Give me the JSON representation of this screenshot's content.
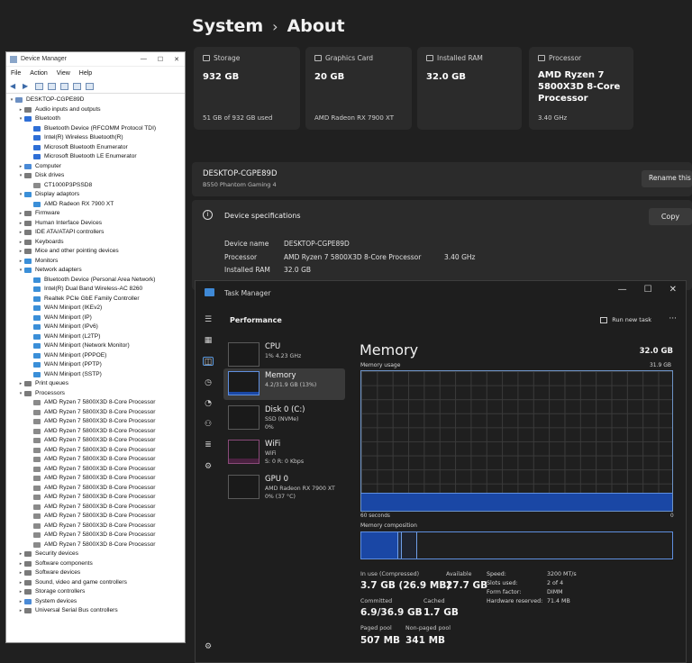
{
  "settings": {
    "crumb_parent": "System",
    "crumb_sep": "›",
    "crumb_current": "About",
    "cards": [
      {
        "label": "Storage",
        "value": "932 GB",
        "sub": "51 GB of 932 GB used"
      },
      {
        "label": "Graphics Card",
        "value": "20 GB",
        "sub": "AMD Radeon RX 7900 XT"
      },
      {
        "label": "Installed RAM",
        "value": "32.0 GB",
        "sub": ""
      },
      {
        "label": "Processor",
        "value": "AMD Ryzen 7 5800X3D 8-Core Processor",
        "sub": "3.40 GHz"
      }
    ],
    "device_name": "DESKTOP-CGPE89D",
    "device_model": "B550 Phantom Gaming 4",
    "rename_label": "Rename this",
    "spec_header": "Device specifications",
    "copy_label": "Copy",
    "specs": [
      {
        "key": "Device name",
        "value": "DESKTOP-CGPE89D",
        "extra": ""
      },
      {
        "key": "Processor",
        "value": "AMD Ryzen 7 5800X3D 8-Core Processor",
        "extra": "3.40 GHz"
      },
      {
        "key": "Installed RAM",
        "value": "32.0 GB",
        "extra": ""
      }
    ]
  },
  "device_manager": {
    "title": "Device Manager",
    "menu": [
      "File",
      "Action",
      "View",
      "Help"
    ],
    "tree": [
      {
        "t": "DESKTOP-CGPE89D",
        "l": 0,
        "a": "v",
        "c": "#6b8fc2"
      },
      {
        "t": "Audio inputs and outputs",
        "l": 1,
        "a": ">",
        "c": "#7a7a7a"
      },
      {
        "t": "Bluetooth",
        "l": 1,
        "a": "v",
        "c": "#2f6fd6"
      },
      {
        "t": "Bluetooth Device (RFCOMM Protocol TDI)",
        "l": 2,
        "a": "",
        "c": "#2f6fd6"
      },
      {
        "t": "Intel(R) Wireless Bluetooth(R)",
        "l": 2,
        "a": "",
        "c": "#2f6fd6"
      },
      {
        "t": "Microsoft Bluetooth Enumerator",
        "l": 2,
        "a": "",
        "c": "#2f6fd6"
      },
      {
        "t": "Microsoft Bluetooth LE Enumerator",
        "l": 2,
        "a": "",
        "c": "#2f6fd6"
      },
      {
        "t": "Computer",
        "l": 1,
        "a": ">",
        "c": "#4a8ad6"
      },
      {
        "t": "Disk drives",
        "l": 1,
        "a": "v",
        "c": "#7a7a7a"
      },
      {
        "t": "CT1000P3PSSD8",
        "l": 2,
        "a": "",
        "c": "#8a8a8a"
      },
      {
        "t": "Display adaptors",
        "l": 1,
        "a": "v",
        "c": "#3b8fd8"
      },
      {
        "t": "AMD Radeon RX 7900 XT",
        "l": 2,
        "a": "",
        "c": "#3b8fd8"
      },
      {
        "t": "Firmware",
        "l": 1,
        "a": ">",
        "c": "#7a7a7a"
      },
      {
        "t": "Human Interface Devices",
        "l": 1,
        "a": ">",
        "c": "#7a7a7a"
      },
      {
        "t": "IDE ATA/ATAPI controllers",
        "l": 1,
        "a": ">",
        "c": "#7a7a7a"
      },
      {
        "t": "Keyboards",
        "l": 1,
        "a": ">",
        "c": "#7a7a7a"
      },
      {
        "t": "Mice and other pointing devices",
        "l": 1,
        "a": ">",
        "c": "#7a7a7a"
      },
      {
        "t": "Monitors",
        "l": 1,
        "a": ">",
        "c": "#3b8fd8"
      },
      {
        "t": "Network adapters",
        "l": 1,
        "a": "v",
        "c": "#3b8fd8"
      },
      {
        "t": "Bluetooth Device (Personal Area Network)",
        "l": 2,
        "a": "",
        "c": "#3b8fd8"
      },
      {
        "t": "Intel(R) Dual Band Wireless-AC 8260",
        "l": 2,
        "a": "",
        "c": "#3b8fd8"
      },
      {
        "t": "Realtek PCIe GbE Family Controller",
        "l": 2,
        "a": "",
        "c": "#3b8fd8"
      },
      {
        "t": "WAN Miniport (IKEv2)",
        "l": 2,
        "a": "",
        "c": "#3b8fd8"
      },
      {
        "t": "WAN Miniport (IP)",
        "l": 2,
        "a": "",
        "c": "#3b8fd8"
      },
      {
        "t": "WAN Miniport (IPv6)",
        "l": 2,
        "a": "",
        "c": "#3b8fd8"
      },
      {
        "t": "WAN Miniport (L2TP)",
        "l": 2,
        "a": "",
        "c": "#3b8fd8"
      },
      {
        "t": "WAN Miniport (Network Monitor)",
        "l": 2,
        "a": "",
        "c": "#3b8fd8"
      },
      {
        "t": "WAN Miniport (PPPOE)",
        "l": 2,
        "a": "",
        "c": "#3b8fd8"
      },
      {
        "t": "WAN Miniport (PPTP)",
        "l": 2,
        "a": "",
        "c": "#3b8fd8"
      },
      {
        "t": "WAN Miniport (SSTP)",
        "l": 2,
        "a": "",
        "c": "#3b8fd8"
      },
      {
        "t": "Print queues",
        "l": 1,
        "a": ">",
        "c": "#7a7a7a"
      },
      {
        "t": "Processors",
        "l": 1,
        "a": "v",
        "c": "#7a7a7a"
      },
      {
        "t": "AMD Ryzen 7 5800X3D 8-Core Processor",
        "l": 2,
        "a": "",
        "c": "#8a8a8a"
      },
      {
        "t": "AMD Ryzen 7 5800X3D 8-Core Processor",
        "l": 2,
        "a": "",
        "c": "#8a8a8a"
      },
      {
        "t": "AMD Ryzen 7 5800X3D 8-Core Processor",
        "l": 2,
        "a": "",
        "c": "#8a8a8a"
      },
      {
        "t": "AMD Ryzen 7 5800X3D 8-Core Processor",
        "l": 2,
        "a": "",
        "c": "#8a8a8a"
      },
      {
        "t": "AMD Ryzen 7 5800X3D 8-Core Processor",
        "l": 2,
        "a": "",
        "c": "#8a8a8a"
      },
      {
        "t": "AMD Ryzen 7 5800X3D 8-Core Processor",
        "l": 2,
        "a": "",
        "c": "#8a8a8a"
      },
      {
        "t": "AMD Ryzen 7 5800X3D 8-Core Processor",
        "l": 2,
        "a": "",
        "c": "#8a8a8a"
      },
      {
        "t": "AMD Ryzen 7 5800X3D 8-Core Processor",
        "l": 2,
        "a": "",
        "c": "#8a8a8a"
      },
      {
        "t": "AMD Ryzen 7 5800X3D 8-Core Processor",
        "l": 2,
        "a": "",
        "c": "#8a8a8a"
      },
      {
        "t": "AMD Ryzen 7 5800X3D 8-Core Processor",
        "l": 2,
        "a": "",
        "c": "#8a8a8a"
      },
      {
        "t": "AMD Ryzen 7 5800X3D 8-Core Processor",
        "l": 2,
        "a": "",
        "c": "#8a8a8a"
      },
      {
        "t": "AMD Ryzen 7 5800X3D 8-Core Processor",
        "l": 2,
        "a": "",
        "c": "#8a8a8a"
      },
      {
        "t": "AMD Ryzen 7 5800X3D 8-Core Processor",
        "l": 2,
        "a": "",
        "c": "#8a8a8a"
      },
      {
        "t": "AMD Ryzen 7 5800X3D 8-Core Processor",
        "l": 2,
        "a": "",
        "c": "#8a8a8a"
      },
      {
        "t": "AMD Ryzen 7 5800X3D 8-Core Processor",
        "l": 2,
        "a": "",
        "c": "#8a8a8a"
      },
      {
        "t": "AMD Ryzen 7 5800X3D 8-Core Processor",
        "l": 2,
        "a": "",
        "c": "#8a8a8a"
      },
      {
        "t": "Security devices",
        "l": 1,
        "a": ">",
        "c": "#7a7a7a"
      },
      {
        "t": "Software components",
        "l": 1,
        "a": ">",
        "c": "#7a7a7a"
      },
      {
        "t": "Software devices",
        "l": 1,
        "a": ">",
        "c": "#7a7a7a"
      },
      {
        "t": "Sound, video and game controllers",
        "l": 1,
        "a": ">",
        "c": "#7a7a7a"
      },
      {
        "t": "Storage controllers",
        "l": 1,
        "a": ">",
        "c": "#7a7a7a"
      },
      {
        "t": "System devices",
        "l": 1,
        "a": ">",
        "c": "#4a8ad6"
      },
      {
        "t": "Universal Serial Bus controllers",
        "l": 1,
        "a": ">",
        "c": "#7a7a7a"
      }
    ]
  },
  "task_manager": {
    "title": "Task Manager",
    "window_controls": [
      "—",
      "☐",
      "✕"
    ],
    "section": "Performance",
    "run_task": "Run new task",
    "more": "···",
    "sidebar": [
      {
        "name": "CPU",
        "s1": "1% 4.23 GHz",
        "s2": ""
      },
      {
        "name": "Memory",
        "s1": "4.2/31.9 GB (13%)",
        "s2": ""
      },
      {
        "name": "Disk 0 (C:)",
        "s1": "SSD (NVMe)",
        "s2": "0%"
      },
      {
        "name": "WiFi",
        "s1": "WiFi",
        "s2": "S: 0 R: 0 Kbps"
      },
      {
        "name": "GPU 0",
        "s1": "AMD Radeon RX 7900 XT",
        "s2": "0% (37 °C)"
      }
    ],
    "memory": {
      "title": "Memory",
      "total": "32.0 GB",
      "usage_label": "Memory usage",
      "usage_max": "31.9 GB",
      "usage_fraction": 0.13,
      "time_left": "60 seconds",
      "time_right": "0",
      "composition_label": "Memory composition",
      "composition": {
        "in_use": 0.12,
        "modified": 0.01,
        "standby": 0.05
      },
      "stats": [
        {
          "label": "In use (Compressed)",
          "value": "3.7 GB (26.9 MB)"
        },
        {
          "label": "Available",
          "value": "27.7 GB"
        },
        {
          "label": "Committed",
          "value": "6.9/36.9 GB"
        },
        {
          "label": "Cached",
          "value": "1.7 GB"
        },
        {
          "label": "Paged pool",
          "value": "507 MB"
        },
        {
          "label": "Non-paged pool",
          "value": "341 MB"
        }
      ],
      "details": [
        {
          "k": "Speed:",
          "v": "3200 MT/s"
        },
        {
          "k": "Slots used:",
          "v": "2 of 4"
        },
        {
          "k": "Form factor:",
          "v": "DIMM"
        },
        {
          "k": "Hardware reserved:",
          "v": "71.4 MB"
        }
      ]
    }
  }
}
